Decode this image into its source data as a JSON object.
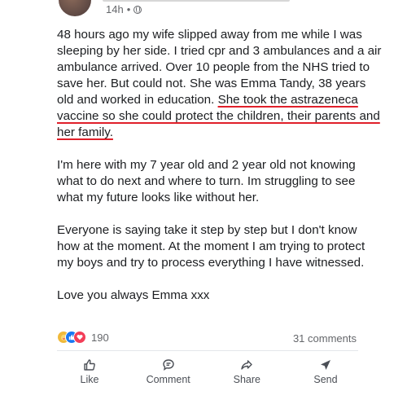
{
  "post": {
    "time": "14h",
    "separator": "•",
    "paragraphs": {
      "p1_before": "48 hours ago my wife slipped away from me while I was sleeping by her side. I tried cpr and 3 ambulances and a air ambulance arrived. Over 10 people from the NHS tried to save her. But could not. She was Emma Tandy, 38 years old and worked in education. ",
      "p1_highlight": "She took the astrazeneca vaccine so she could protect the children, their parents and her family.",
      "p2": "I'm here with my 7 year old and 2 year old not knowing what to do next and where to turn. Im struggling to see what my future looks like without her.",
      "p3": "Everyone is saying take it step by step but I don't know how at the moment. At the moment I am trying to protect my boys and try to process everything I have witnessed.",
      "p4": "Love you always Emma xxx"
    }
  },
  "reactions": {
    "count": "190",
    "icons": [
      "care-icon",
      "like-icon",
      "love-icon"
    ]
  },
  "comments": {
    "label": "31 comments"
  },
  "actions": {
    "like": "Like",
    "comment": "Comment",
    "share": "Share",
    "send": "Send"
  },
  "colors": {
    "highlight_underline": "#e0202a",
    "like_blue": "#1877f2",
    "love_red": "#f33e58"
  }
}
